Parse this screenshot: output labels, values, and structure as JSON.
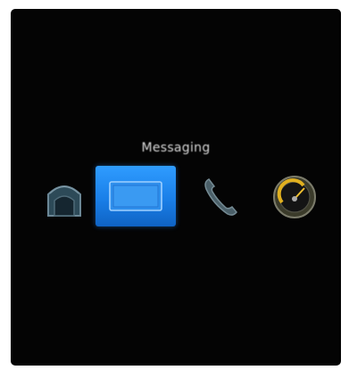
{
  "app_bar": {
    "focused_label": "Messaging",
    "items": [
      {
        "id": "home",
        "icon": "home-icon"
      },
      {
        "id": "messages",
        "icon": "messages-icon",
        "selected": true
      },
      {
        "id": "phone",
        "icon": "phone-icon"
      },
      {
        "id": "dashboard",
        "icon": "speedometer-icon"
      }
    ]
  },
  "colors": {
    "background": "#040404",
    "selection": "#1a7fe8",
    "label": "#d9d9d9"
  }
}
